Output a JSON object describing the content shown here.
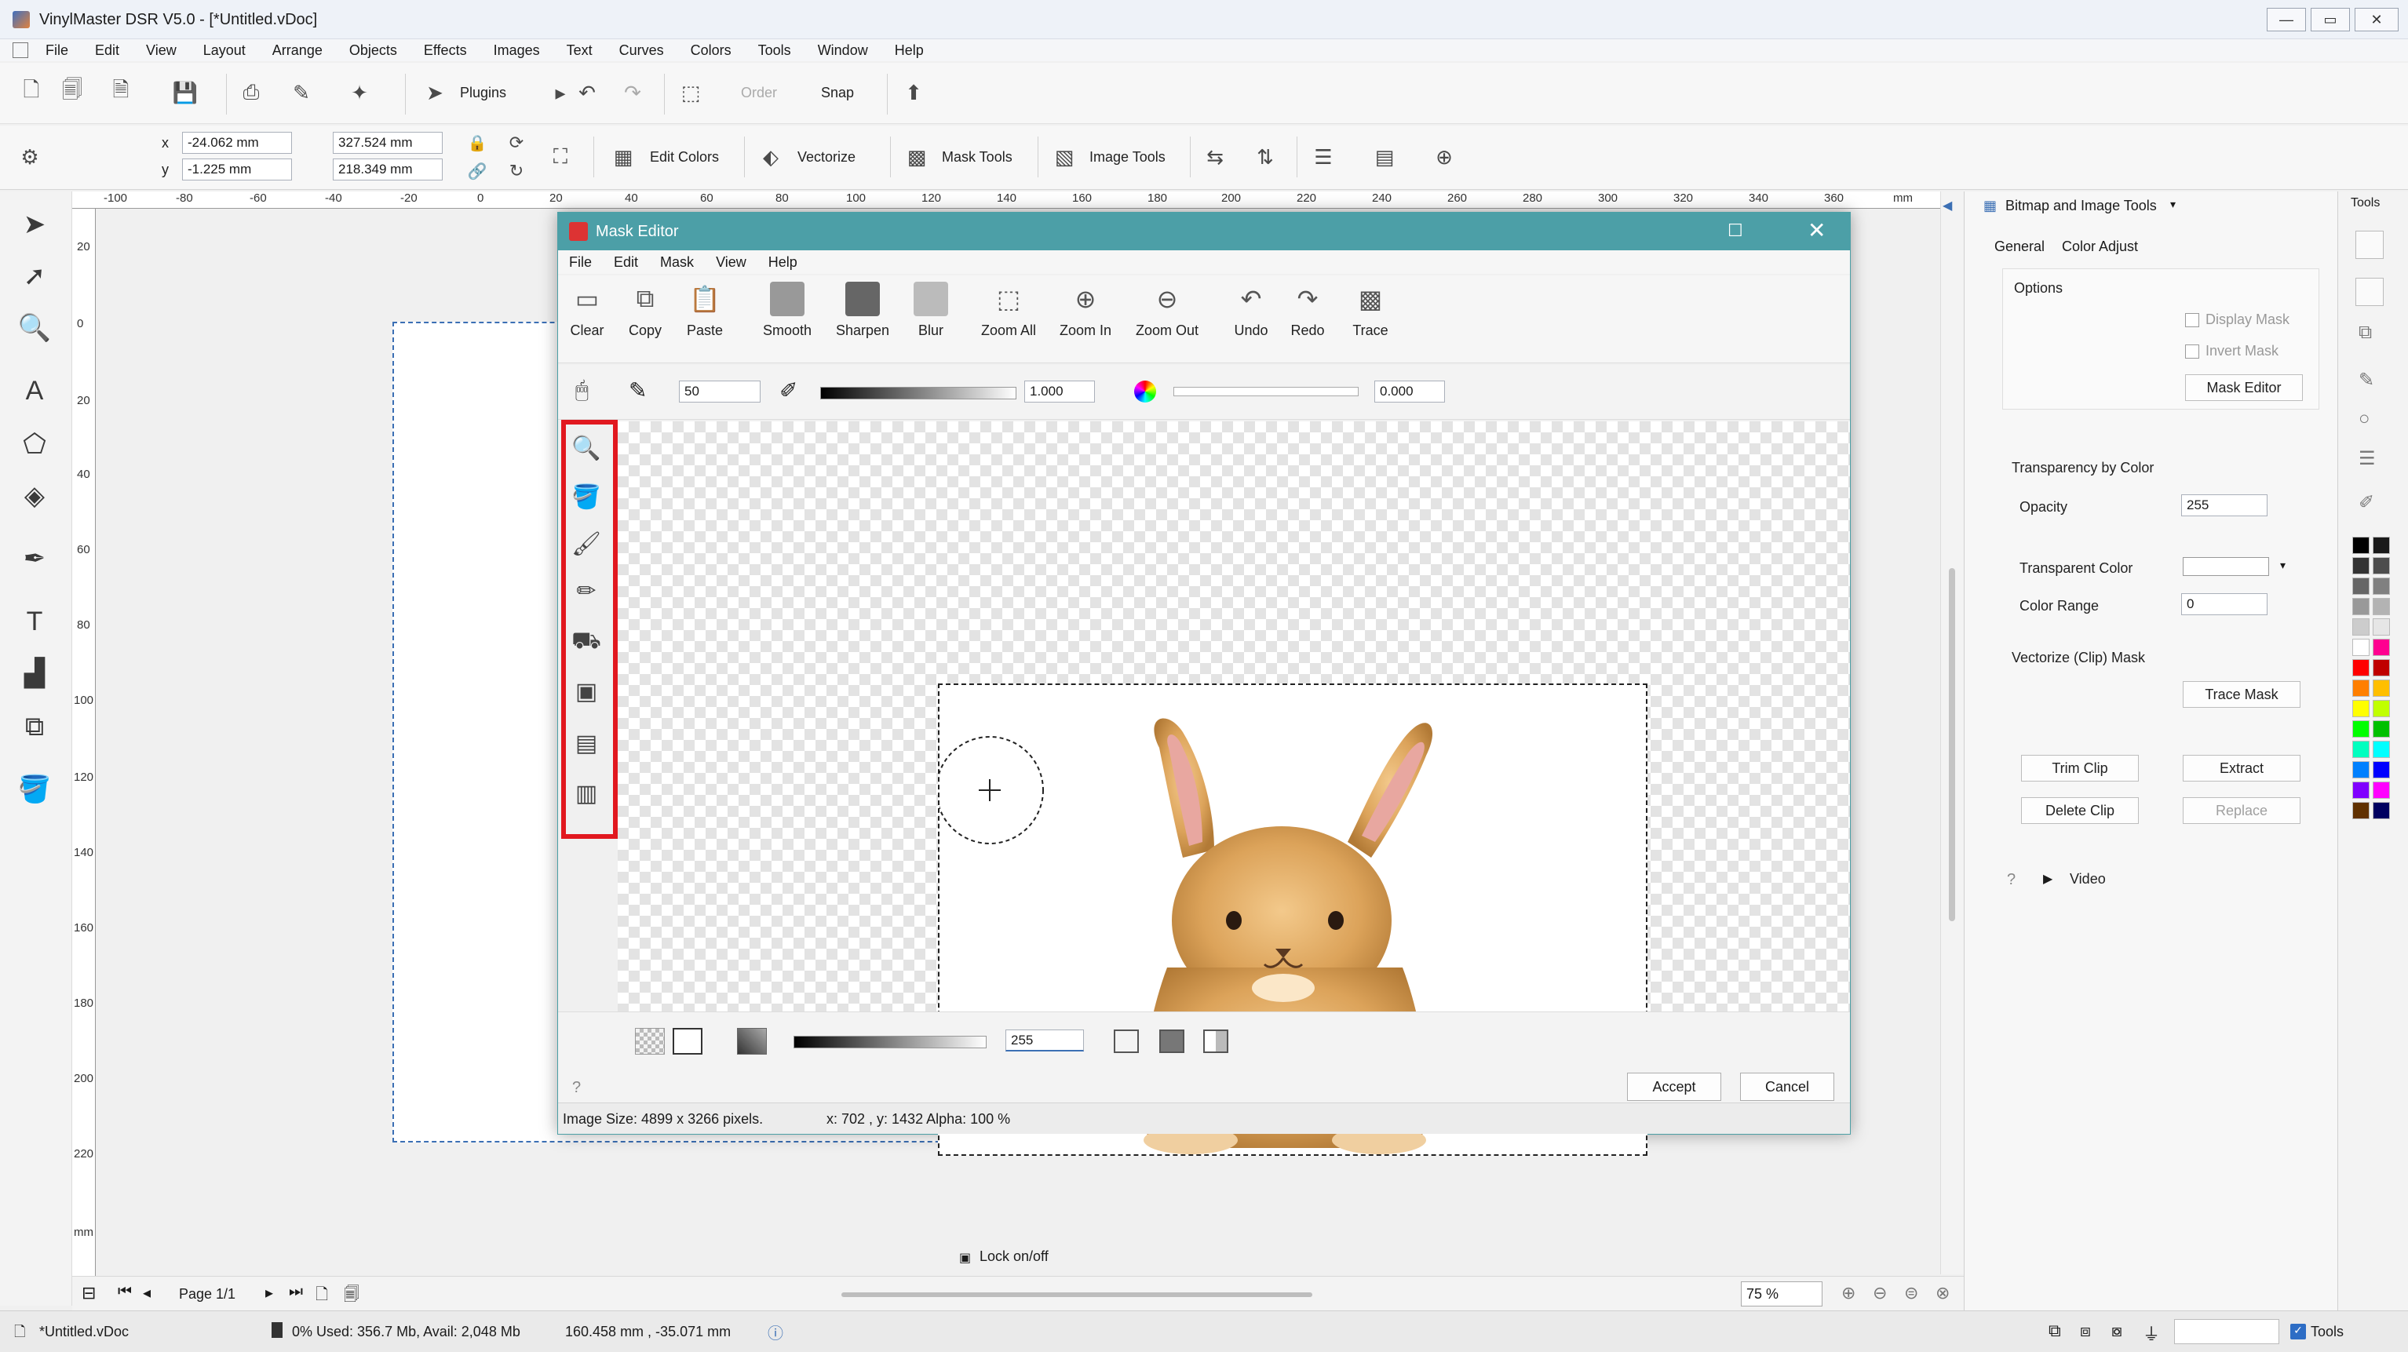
{
  "app": {
    "title": "VinylMaster DSR V5.0 - [*Untitled.vDoc]",
    "window_buttons": [
      "—",
      "▭",
      "✕"
    ],
    "menu": [
      "File",
      "Edit",
      "View",
      "Layout",
      "Arrange",
      "Objects",
      "Effects",
      "Images",
      "Text",
      "Curves",
      "Colors",
      "Tools",
      "Window",
      "Help"
    ]
  },
  "toolbar1": {
    "plugins": "Plugins",
    "order": "Order",
    "snap": "Snap"
  },
  "toolbar2": {
    "x_label": "x",
    "y_label": "y",
    "x_value": "-24.062 mm",
    "y_value": "-1.225 mm",
    "w_value": "327.524 mm",
    "h_value": "218.349 mm",
    "edit_colors": "Edit Colors",
    "vectorize": "Vectorize",
    "mask_tools": "Mask Tools",
    "image_tools": "Image Tools"
  },
  "ruler": {
    "top": [
      "-100",
      "-80",
      "-60",
      "-40",
      "-20",
      "0",
      "20",
      "40",
      "60",
      "80",
      "100",
      "120",
      "140",
      "160",
      "180",
      "200",
      "220",
      "240",
      "260",
      "280",
      "300",
      "320",
      "340",
      "360",
      "mm"
    ],
    "left": [
      "20",
      "0",
      "20",
      "40",
      "60",
      "80",
      "100",
      "120",
      "140",
      "160",
      "180",
      "200",
      "220",
      "mm"
    ]
  },
  "nav": {
    "page": "Page 1/1",
    "lock": "Lock on/off",
    "zoom": "75 %"
  },
  "status": {
    "doc": "*Untitled.vDoc",
    "memory": "0%  Used: 356.7 Mb, Avail: 2,048 Mb",
    "coords": "160.458 mm , -35.071 mm",
    "tools": "Tools"
  },
  "rightpanel": {
    "title": "Bitmap and Image Tools",
    "tabs": [
      "General",
      "Color Adjust"
    ],
    "options_label": "Options",
    "display_mask": "Display Mask",
    "invert_mask": "Invert Mask",
    "mask_editor_btn": "Mask Editor",
    "transparency_label": "Transparency by Color",
    "opacity_label": "Opacity",
    "opacity_value": "255",
    "transparent_color_label": "Transparent Color",
    "color_range_label": "Color Range",
    "color_range_value": "0",
    "vectorize_label": "Vectorize (Clip) Mask",
    "trace_mask_btn": "Trace Mask",
    "trim_clip_btn": "Trim Clip",
    "extract_btn": "Extract",
    "delete_clip_btn": "Delete Clip",
    "replace_btn": "Replace",
    "video_label": "Video",
    "tools_tab": "Tools"
  },
  "dialog": {
    "title": "Mask Editor",
    "menu": [
      "File",
      "Edit",
      "Mask",
      "View",
      "Help"
    ],
    "tools": [
      "Clear",
      "Copy",
      "Paste",
      "Smooth",
      "Sharpen",
      "Blur",
      "Zoom All",
      "Zoom In",
      "Zoom Out",
      "Undo",
      "Redo",
      "Trace"
    ],
    "brush_size": "50",
    "opacity_value": "1.000",
    "hue_value": "0.000",
    "mask_value": "255",
    "accept": "Accept",
    "cancel": "Cancel",
    "status_size": "Image Size: 4899 x 3266 pixels.",
    "status_pos": "x: 702 , y: 1432  Alpha: 100 %"
  },
  "colors": {
    "accent": "#4c9fa7",
    "highlight": "#e1181f",
    "palette": [
      "#000000",
      "#1a1a1a",
      "#333333",
      "#4d4d4d",
      "#666666",
      "#808080",
      "#999999",
      "#b3b3b3",
      "#cccccc",
      "#e6e6e6",
      "#ffffff",
      "#ff0090",
      "#ff0000",
      "#c00000",
      "#ff7f00",
      "#ffbf00",
      "#ffff00",
      "#c0ff00",
      "#00ff00",
      "#00c000",
      "#00ffbf",
      "#00ffff",
      "#0080ff",
      "#0000ff",
      "#8000ff",
      "#ff00ff",
      "#603000",
      "#000060"
    ]
  }
}
